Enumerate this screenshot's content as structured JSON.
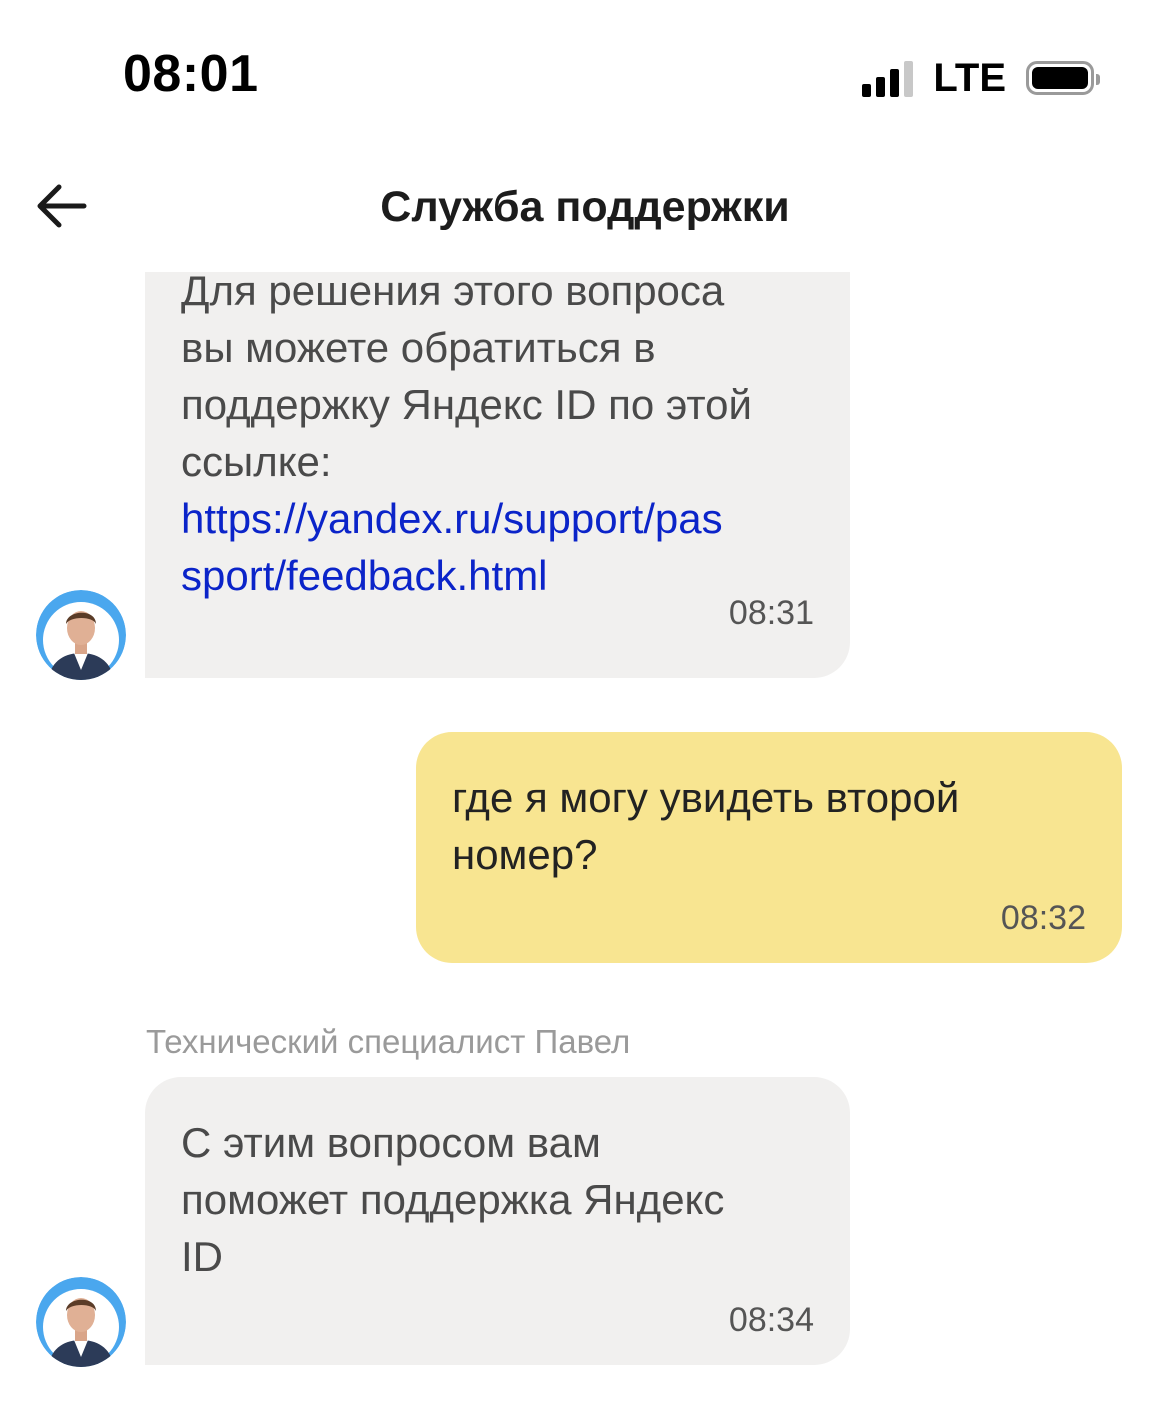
{
  "status_bar": {
    "time": "08:01",
    "network": "LTE",
    "icons": [
      "signal-icon",
      "battery-icon"
    ]
  },
  "header": {
    "title": "Служба поддержки",
    "back_icon": "arrow-left-icon"
  },
  "messages": [
    {
      "direction": "incoming",
      "text": "Для решения этого вопроса\nвы можете обратиться в\nподдержку Яндекс ID по этой\nссылке:",
      "link": "https://yandex.ru/support/pas\nsport/feedback.html",
      "time": "08:31"
    },
    {
      "direction": "outgoing",
      "text": "где я могу увидеть второй\nномер?",
      "time": "08:32"
    },
    {
      "direction": "incoming",
      "sender": "Технический специалист Павел",
      "text": "С этим вопросом вам\nпоможет поддержка Яндекс\nID",
      "time": "08:34"
    }
  ],
  "colors": {
    "incoming_bubble": "#f1f0ef",
    "outgoing_bubble": "#f8e591",
    "link": "#0b24c9",
    "avatar_ring": "#4aa7ee"
  }
}
